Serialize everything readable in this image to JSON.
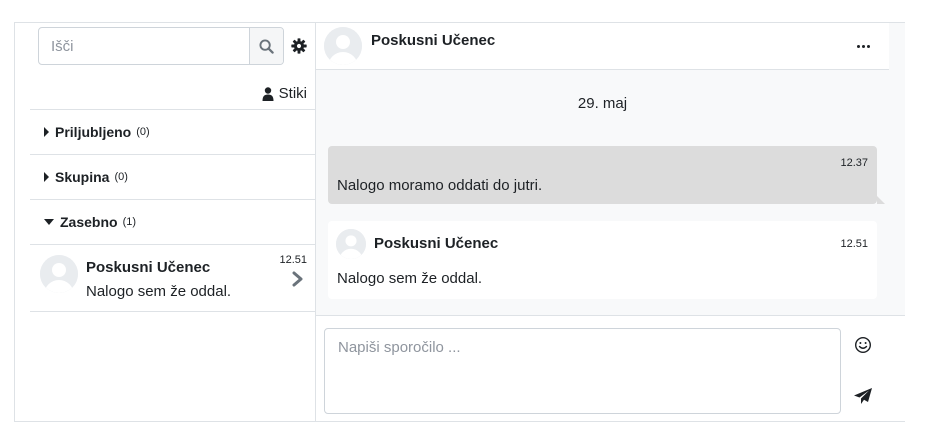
{
  "left": {
    "search": {
      "placeholder": "Išči"
    },
    "contacts_label": "Stiki",
    "sections": [
      {
        "label": "Priljubljeno",
        "count": "(0)",
        "expanded": false
      },
      {
        "label": "Skupina",
        "count": "(0)",
        "expanded": false
      },
      {
        "label": "Zasebno",
        "count": "(1)",
        "expanded": true
      }
    ],
    "conversation": {
      "name": "Poskusni Učenec",
      "last_message": "Nalogo sem že oddal.",
      "time": "12.51"
    }
  },
  "right": {
    "header": {
      "name": "Poskusni Učenec",
      "more_icon": "ellipsis-icon"
    },
    "date": "29. maj",
    "messages": [
      {
        "type": "sent",
        "time": "12.37",
        "text": "Nalogo moramo oddati do jutri."
      },
      {
        "type": "received",
        "name": "Poskusni Učenec",
        "time": "12.51",
        "text": "Nalogo sem že oddal."
      }
    ],
    "compose": {
      "placeholder": "Napiši sporočilo ..."
    }
  },
  "colors": {
    "sent_bubble": "#dcdcdc",
    "panel_bg": "#f8f9fa",
    "border": "#dee2e6",
    "text": "#1d2125"
  }
}
